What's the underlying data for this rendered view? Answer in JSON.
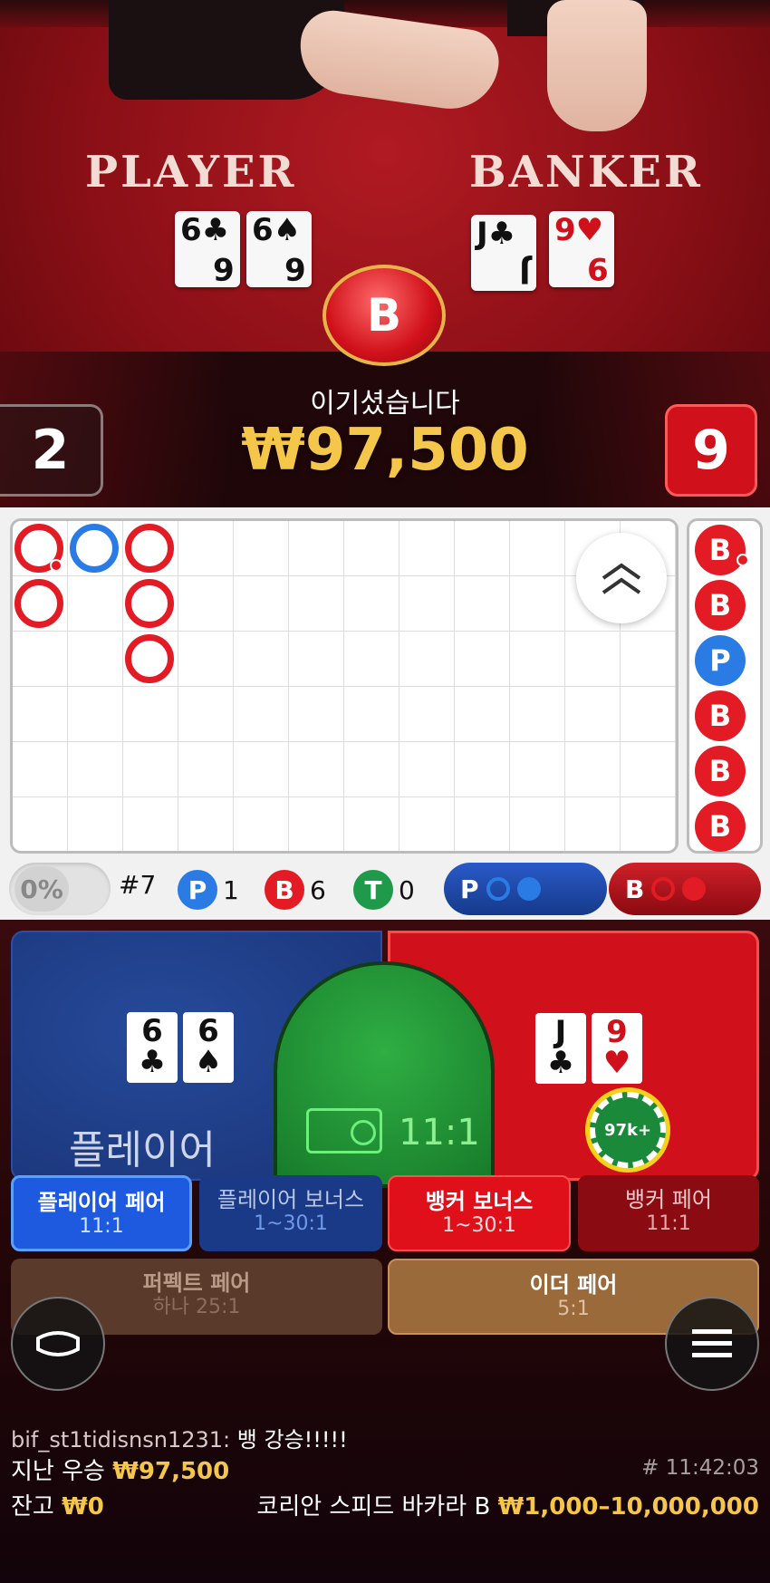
{
  "video": {
    "player_title": "PLAYER",
    "banker_title": "BANKER",
    "player_cards": [
      {
        "rank": "6",
        "suit": "♣",
        "color": "black"
      },
      {
        "rank": "6",
        "suit": "♠",
        "color": "black"
      }
    ],
    "banker_cards": [
      {
        "rank": "J",
        "suit": "♣",
        "color": "black"
      },
      {
        "rank": "9",
        "suit": "♥",
        "color": "red"
      }
    ],
    "winner_badge": "B",
    "win_label": "이기셨습니다",
    "win_amount": "₩97,500",
    "player_score": "2",
    "banker_score": "9"
  },
  "roadmap": {
    "big_road": [
      {
        "col": 0,
        "row": 0,
        "side": "banker",
        "marker": true
      },
      {
        "col": 0,
        "row": 1,
        "side": "banker"
      },
      {
        "col": 1,
        "row": 0,
        "side": "player"
      },
      {
        "col": 2,
        "row": 0,
        "side": "banker"
      },
      {
        "col": 2,
        "row": 1,
        "side": "banker"
      },
      {
        "col": 2,
        "row": 2,
        "side": "banker"
      }
    ],
    "bead_column": [
      {
        "label": "B",
        "side": "b",
        "marker": true
      },
      {
        "label": "B",
        "side": "b"
      },
      {
        "label": "P",
        "side": "p"
      },
      {
        "label": "B",
        "side": "b"
      },
      {
        "label": "B",
        "side": "b"
      },
      {
        "label": "B",
        "side": "b"
      }
    ],
    "expand_icon": "double-chevron-up-icon"
  },
  "stats": {
    "percent": "0%",
    "round": "#7",
    "player_label": "P",
    "player_count": "1",
    "banker_label": "B",
    "banker_count": "6",
    "tie_label": "T",
    "tie_count": "0",
    "predict_player": "P",
    "predict_banker": "B",
    "colors": {
      "player": "#2a7be4",
      "banker": "#e31b24",
      "tie": "#1f9a4a"
    }
  },
  "bets": {
    "player_spot_label": "플레이어",
    "tie_odds": "11:1",
    "chip_label": "97k+",
    "player_pair": {
      "label": "플레이어 페어",
      "odds": "11:1"
    },
    "player_bonus": {
      "label": "플레이어 보너스",
      "odds": "1~30:1"
    },
    "banker_bonus": {
      "label": "뱅커 보너스",
      "odds": "1~30:1"
    },
    "banker_pair": {
      "label": "뱅커 페어",
      "odds": "11:1"
    },
    "perfect_pair": {
      "label": "퍼펙트 페어",
      "odds": "하나 25:1"
    },
    "either_pair": {
      "label": "이더 페어",
      "odds": "5:1"
    }
  },
  "footer": {
    "chat_user": "bif_st1tidisnsn1231:",
    "chat_message": "뱅 강승!!!!!",
    "last_win_label": "지난 우승",
    "last_win_value": "₩97,500",
    "balance_label": "잔고",
    "balance_value": "₩0",
    "game_id": "# 11:42:03",
    "table_name": "코리안 스피드 바카라 B",
    "table_limits": "₩1,000–10,000,000"
  }
}
